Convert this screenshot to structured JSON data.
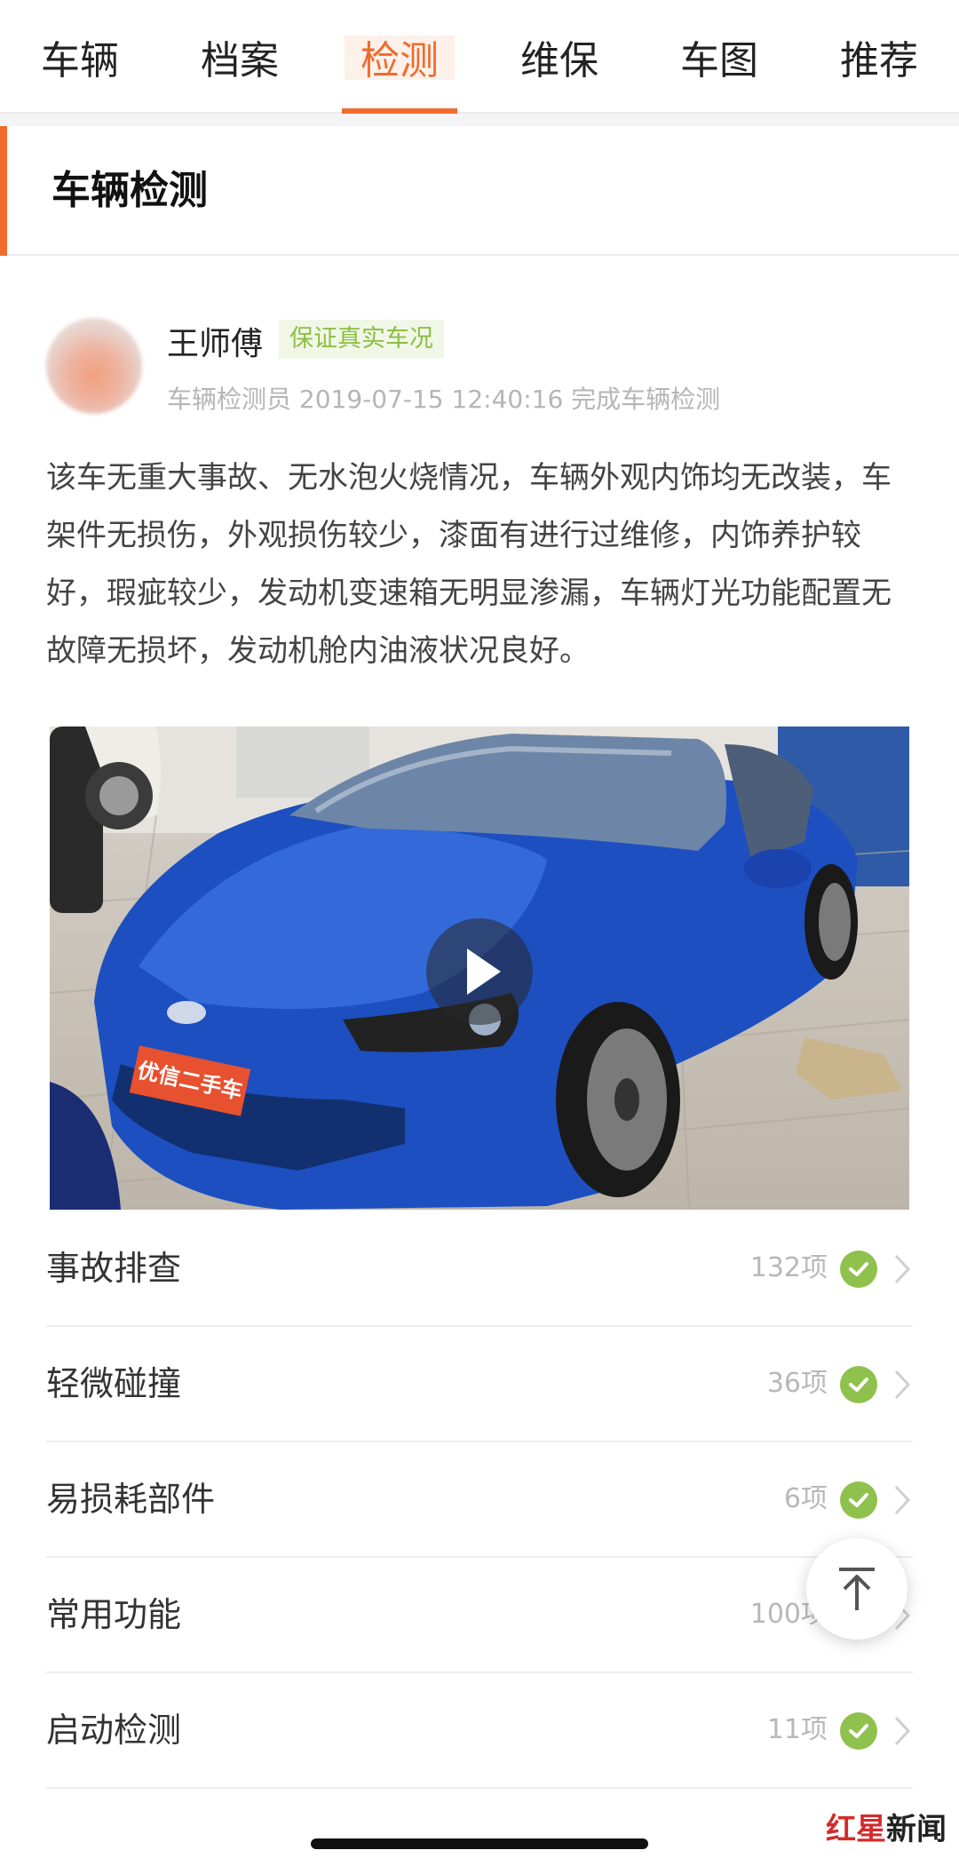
{
  "tabs": [
    {
      "label": "车辆",
      "active": false
    },
    {
      "label": "档案",
      "active": false
    },
    {
      "label": "检测",
      "active": true
    },
    {
      "label": "维保",
      "active": false
    },
    {
      "label": "车图",
      "active": false
    },
    {
      "label": "推荐",
      "active": false
    }
  ],
  "section": {
    "title": "车辆检测"
  },
  "inspector": {
    "name": "王师傅",
    "badge": "保证真实车况",
    "meta": "车辆检测员 2019-07-15 12:40:16 完成车辆检测"
  },
  "summary": "该车无重大事故、无水泡火烧情况，车辆外观内饰均无改装，车架件无损伤，外观损伤较少，漆面有进行过维修，内饰养护较好，瑕疵较少，发动机变速箱无明显渗漏，车辆灯光功能配置无故障无损坏，发动机舱内油液状况良好。",
  "video": {
    "plate_text": "优信二手车"
  },
  "checks": [
    {
      "label": "事故排查",
      "count": "132项"
    },
    {
      "label": "轻微碰撞",
      "count": "36项"
    },
    {
      "label": "易损耗部件",
      "count": "6项"
    },
    {
      "label": "常用功能",
      "count": "100项"
    },
    {
      "label": "启动检测",
      "count": "11项"
    }
  ],
  "watermark": {
    "part1": "红星",
    "part2": "新闻"
  },
  "colors": {
    "accent": "#ef6b2e",
    "check": "#8fc14d",
    "badge_text": "#8bbf43"
  }
}
